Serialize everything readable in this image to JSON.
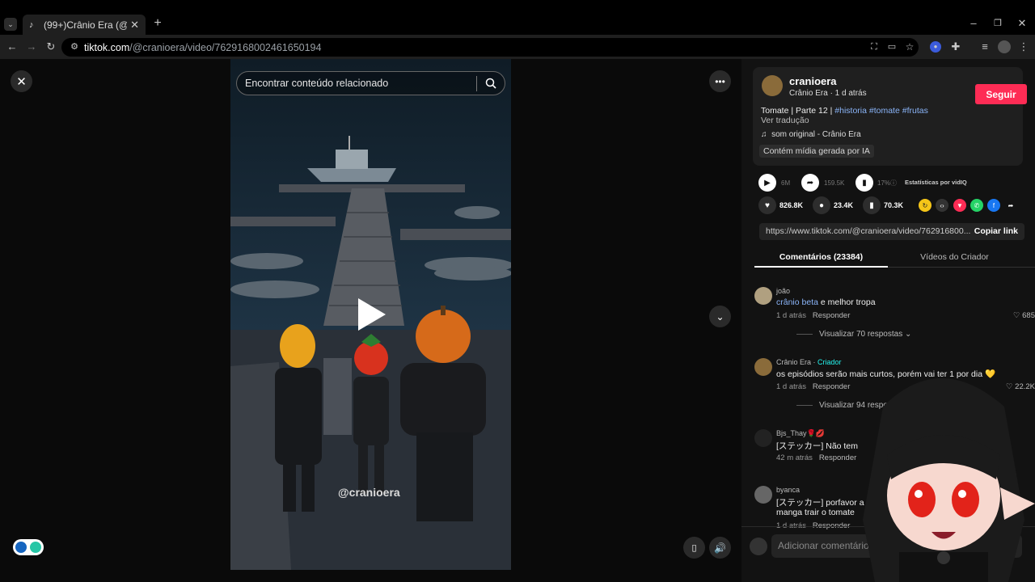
{
  "browser": {
    "tab_title": "(99+)Crânio Era (@cranioera) |",
    "url_host": "tiktok.com",
    "url_path": "/@cranioera/video/7629168002461650194"
  },
  "video": {
    "search_placeholder": "Encontrar conteúdo relacionado",
    "watermark": "@cranioera"
  },
  "creator": {
    "name": "cranioera",
    "sub": "Crânio Era · 1 d atrás",
    "follow_label": "Seguir",
    "caption_title": "Tomate | Parte 12 |",
    "hashtags": "#historia #tomate #frutas",
    "translate": "Ver tradução",
    "sound": "som original - Crânio Era",
    "ai_label": "Contém mídia gerada por IA"
  },
  "stats": {
    "plays": "6M",
    "shares_count": "159.5K",
    "percent": "17%",
    "vidiq": "Estatísticas por vidIQ",
    "likes": "826.8K",
    "comments": "23.4K",
    "saves": "70.3K"
  },
  "link": {
    "url": "https://www.tiktok.com/@cranioera/video/762916800...",
    "copy_label": "Copiar link"
  },
  "tabs": {
    "comments": "Comentários (23384)",
    "creator_videos": "Vídeos do Criador"
  },
  "comments": [
    {
      "user": "joão",
      "mention": "crânio beta",
      "text": " e melhor tropa",
      "time": "1 d atrás",
      "reply": "Responder",
      "likes": "685",
      "replies": "Visualizar 70 respostas"
    },
    {
      "user": "Crânio Era",
      "badge": "Criador",
      "text": "os episódios serão mais curtos, porém vai ter 1 por dia 💛",
      "time": "1 d atrás",
      "reply": "Responder",
      "likes": "22.2K",
      "replies": "Visualizar 94 respostas"
    },
    {
      "user": "Bjs_Thay🌹💋",
      "text": "[ステッカー] Não tem",
      "time": "42 m atrás",
      "reply": "Responder"
    },
    {
      "user": "byanca",
      "text": "[ステッカー] porfavor a",
      "text2": "manga trair o tomate",
      "time": "1 d atrás",
      "reply": "Responder"
    }
  ],
  "comment_input_placeholder": "Adicionar comentário",
  "colors": {
    "accent": "#fe2c55",
    "hashtag": "#8ab4f8",
    "creator_badge": "#25f4ee"
  }
}
